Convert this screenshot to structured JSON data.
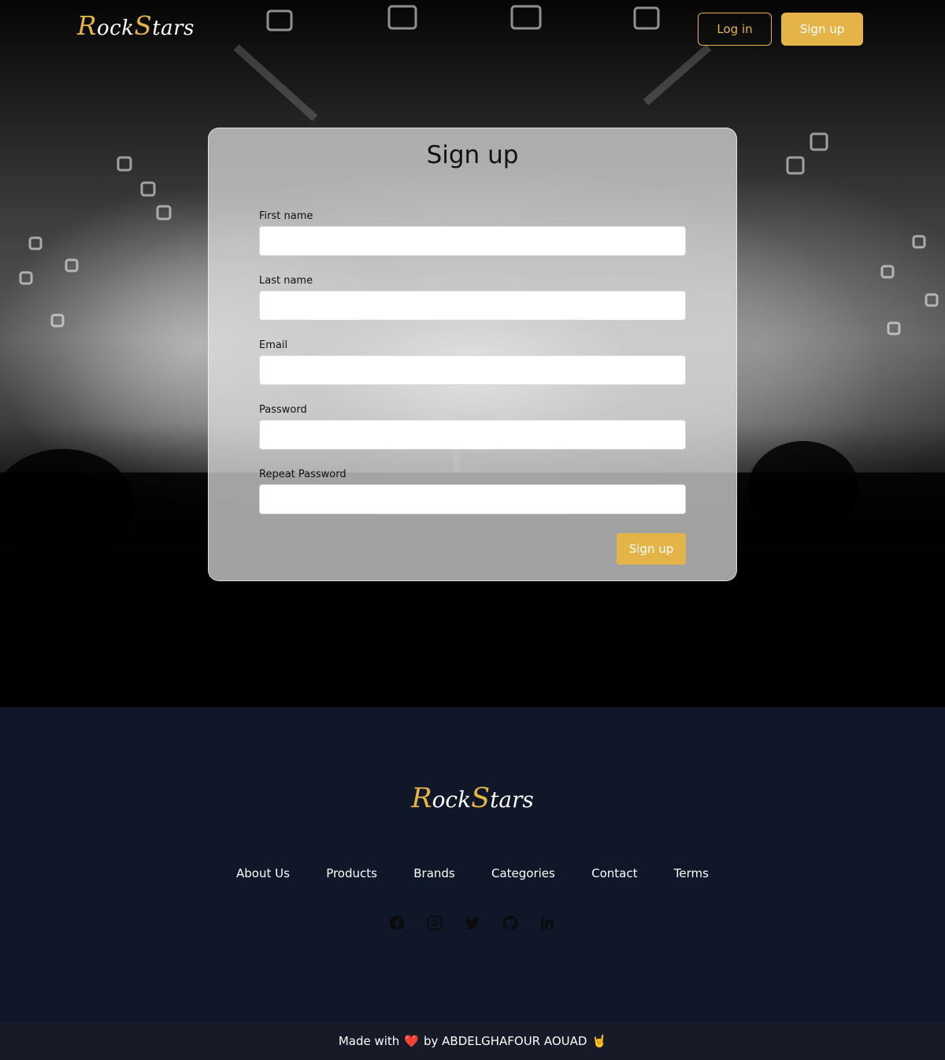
{
  "brand": {
    "logo_initial_1": "R",
    "logo_part_1": "ock",
    "logo_initial_2": "S",
    "logo_part_2": "tars",
    "accent_color": "#e4b448"
  },
  "nav": {
    "login_label": "Log in",
    "signup_label": "Sign up"
  },
  "form": {
    "title": "Sign up",
    "fields": [
      {
        "label": "First name",
        "value": "",
        "placeholder": ""
      },
      {
        "label": "Last name",
        "value": "",
        "placeholder": ""
      },
      {
        "label": "Email",
        "value": "",
        "placeholder": ""
      },
      {
        "label": "Password",
        "value": "",
        "placeholder": ""
      },
      {
        "label": "Repeat Password",
        "value": "",
        "placeholder": ""
      }
    ],
    "submit_label": "Sign up"
  },
  "footer": {
    "links": [
      "About Us",
      "Products",
      "Brands",
      "Categories",
      "Contact",
      "Terms"
    ],
    "socials": [
      "facebook-icon",
      "instagram-icon",
      "twitter-icon",
      "github-icon",
      "linkedin-icon"
    ],
    "credit_prefix": "Made with",
    "heart": "❤️",
    "credit_suffix": "by ABDELGHAFOUR AOUAD",
    "credit_emoji": "🤘",
    "background_color": "#0f1729"
  }
}
